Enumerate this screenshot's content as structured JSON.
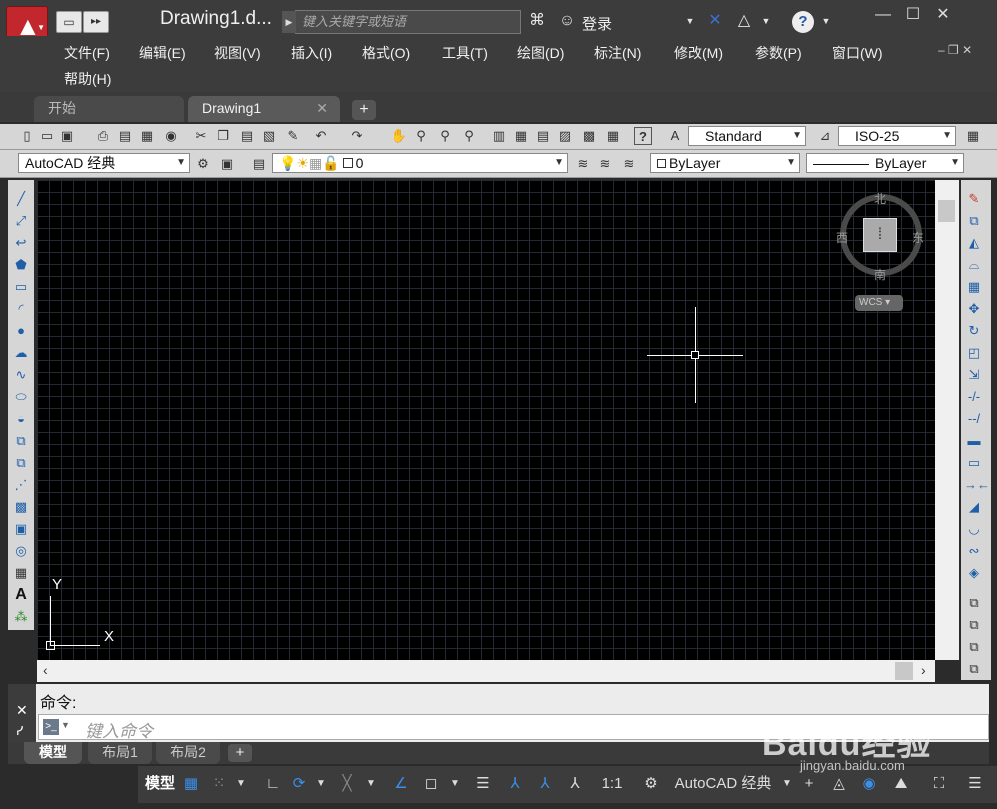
{
  "window": {
    "doc_title": "Drawing1.d...",
    "search_placeholder": "键入关键字或短语",
    "login": "登录",
    "controls": {
      "min": "—",
      "max": "☐",
      "close": "✕"
    }
  },
  "menus": [
    {
      "label": "文件(F)"
    },
    {
      "label": "编辑(E)"
    },
    {
      "label": "视图(V)"
    },
    {
      "label": "插入(I)"
    },
    {
      "label": "格式(O)"
    },
    {
      "label": "工具(T)"
    },
    {
      "label": "绘图(D)"
    },
    {
      "label": "标注(N)"
    },
    {
      "label": "修改(M)"
    },
    {
      "label": "参数(P)"
    },
    {
      "label": "窗口(W)"
    },
    {
      "label": "帮助(H)"
    }
  ],
  "doc_tabs": [
    {
      "label": "开始",
      "active": false
    },
    {
      "label": "Drawing1",
      "active": true
    }
  ],
  "toolbar": {
    "text_style": "Standard",
    "dim_style": "ISO-25",
    "workspace": "AutoCAD 经典",
    "layer": "0",
    "color": "ByLayer",
    "linetype": "ByLayer"
  },
  "viewcube": {
    "north": "北",
    "south": "南",
    "east": "东",
    "west": "西",
    "ucs": "WCS"
  },
  "ucs_axes": {
    "x": "X",
    "y": "Y"
  },
  "command": {
    "history": "命令:",
    "placeholder": "键入命令"
  },
  "layout_tabs": [
    {
      "label": "模型",
      "active": true
    },
    {
      "label": "布局1",
      "active": false
    },
    {
      "label": "布局2",
      "active": false
    }
  ],
  "status": {
    "model": "模型",
    "scale": "1:1",
    "workspace": "AutoCAD 经典"
  },
  "watermark": {
    "line1": "Baidu经验",
    "line2": "jingyan.baidu.com"
  },
  "colors": {
    "accent": "#c1272d",
    "canvas": "#000000",
    "ui_dark": "#3c3c3c"
  }
}
